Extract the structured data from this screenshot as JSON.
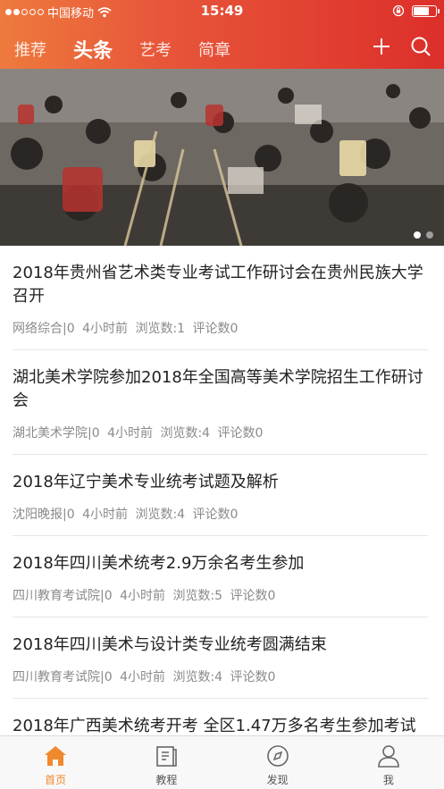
{
  "status_bar": {
    "carrier": "中国移动",
    "time": "15:49"
  },
  "nav": {
    "tabs": [
      {
        "label": "推荐",
        "active": false
      },
      {
        "label": "头条",
        "active": true
      },
      {
        "label": "艺考",
        "active": false
      },
      {
        "label": "简章",
        "active": false
      }
    ]
  },
  "banner": {
    "page_count": 2,
    "current_page": 1
  },
  "news": [
    {
      "title": "2018年贵州省艺术类专业考试工作研讨会在贵州民族大学召开",
      "source": "网络综合|0",
      "time": "4小时前",
      "views": "浏览数:1",
      "comments": "评论数0"
    },
    {
      "title": "湖北美术学院参加2018年全国高等美术学院招生工作研讨会",
      "source": "湖北美术学院|0",
      "time": "4小时前",
      "views": "浏览数:4",
      "comments": "评论数0"
    },
    {
      "title": "2018年辽宁美术专业统考试题及解析",
      "source": "沈阳晚报|0",
      "time": "4小时前",
      "views": "浏览数:4",
      "comments": "评论数0"
    },
    {
      "title": "2018年四川美术统考2.9万余名考生参加",
      "source": "四川教育考试院|0",
      "time": "4小时前",
      "views": "浏览数:5",
      "comments": "评论数0"
    },
    {
      "title": "2018年四川美术与设计类专业统考圆满结束",
      "source": "四川教育考试院|0",
      "time": "4小时前",
      "views": "浏览数:4",
      "comments": "评论数0"
    },
    {
      "title": "2018年广西美术统考开考 全区1.47万多名考生参加考试",
      "source": "",
      "time": "",
      "views": "",
      "comments": ""
    }
  ],
  "tabbar": [
    {
      "label": "首页",
      "icon": "home-icon",
      "active": true
    },
    {
      "label": "教程",
      "icon": "book-icon",
      "active": false
    },
    {
      "label": "发现",
      "icon": "compass-icon",
      "active": false
    },
    {
      "label": "我",
      "icon": "person-icon",
      "active": false
    }
  ],
  "colors": {
    "header_start": "#ee7a3d",
    "header_end": "#dc2f2a",
    "accent": "#f0892e"
  }
}
